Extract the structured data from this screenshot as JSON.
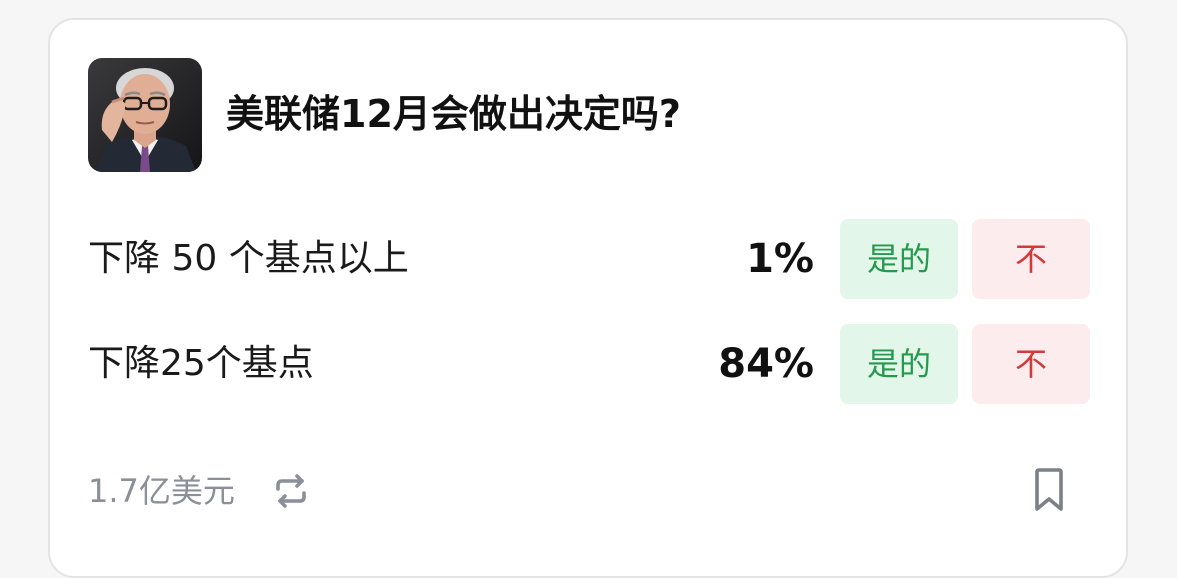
{
  "market": {
    "title": "美联储12月会做出决定吗?",
    "avatar_icon": "person-portrait-photo"
  },
  "outcomes": [
    {
      "label": "下降 50 个基点以上",
      "probability": "1%",
      "yes_label": "是的",
      "no_label": "不"
    },
    {
      "label": "下降25个基点",
      "probability": "84%",
      "yes_label": "是的",
      "no_label": "不"
    }
  ],
  "footer": {
    "volume": "1.7亿美元",
    "repeat_icon": "repeat-arrows-icon",
    "bookmark_icon": "bookmark-icon"
  },
  "colors": {
    "yes_bg": "#e3f6ea",
    "yes_text": "#26994e",
    "no_bg": "#fdecee",
    "no_text": "#d23a3a",
    "muted_text": "#8a8f98"
  }
}
